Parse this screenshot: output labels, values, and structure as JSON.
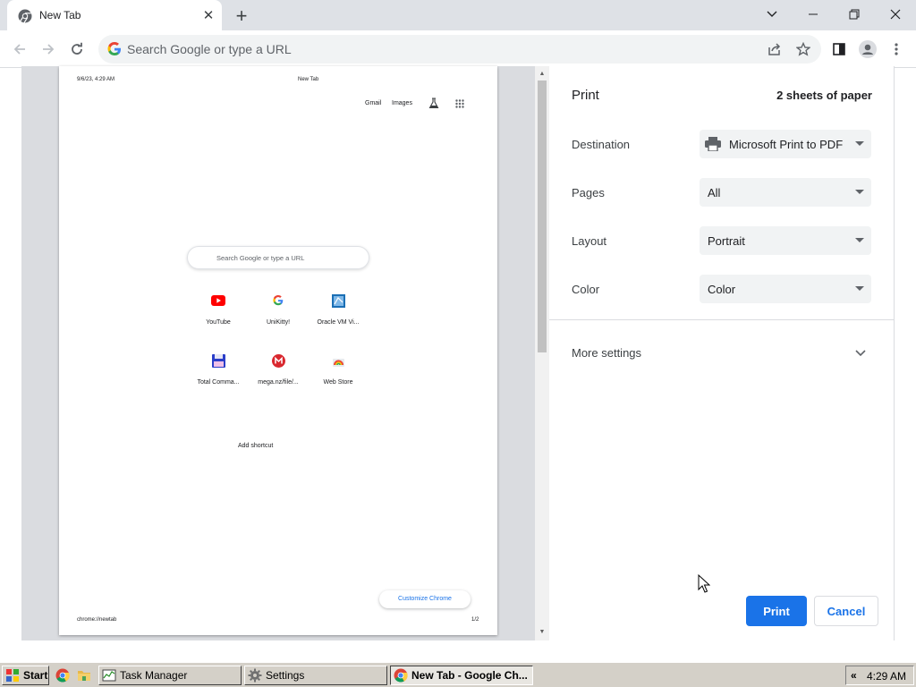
{
  "browser": {
    "tab_title": "New Tab",
    "omnibox_placeholder": "Search Google or type a URL"
  },
  "preview": {
    "header_datetime": "9/6/23, 4:29 AM",
    "header_title": "New Tab",
    "links": {
      "gmail": "Gmail",
      "images": "Images"
    },
    "search_placeholder": "Search Google or type a URL",
    "shortcuts": [
      {
        "label": "YouTube",
        "icon": "youtube-icon"
      },
      {
        "label": "UniKitty!",
        "icon": "google-icon"
      },
      {
        "label": "Oracle VM Vi...",
        "icon": "virtualbox-icon"
      },
      {
        "label": "Total Comma...",
        "icon": "floppy-icon"
      },
      {
        "label": "mega.nz/file/...",
        "icon": "mega-icon"
      },
      {
        "label": "Web Store",
        "icon": "webstore-icon"
      }
    ],
    "add_shortcut": "Add shortcut",
    "customize": "Customize Chrome",
    "footer_url": "chrome://newtab",
    "footer_page": "1/2"
  },
  "print": {
    "title": "Print",
    "sheets": "2 sheets of paper",
    "destination_label": "Destination",
    "destination_value": "Microsoft Print to PDF",
    "pages_label": "Pages",
    "pages_value": "All",
    "layout_label": "Layout",
    "layout_value": "Portrait",
    "color_label": "Color",
    "color_value": "Color",
    "more_settings": "More settings",
    "print_button": "Print",
    "cancel_button": "Cancel"
  },
  "taskbar": {
    "start": "Start",
    "items": [
      "Task Manager",
      "Settings",
      "New Tab - Google Ch..."
    ],
    "clock": "4:29 AM"
  },
  "colors": {
    "accent": "#1a73e8",
    "tabstrip": "#dee1e6",
    "taskbar": "#d4d0c8"
  }
}
